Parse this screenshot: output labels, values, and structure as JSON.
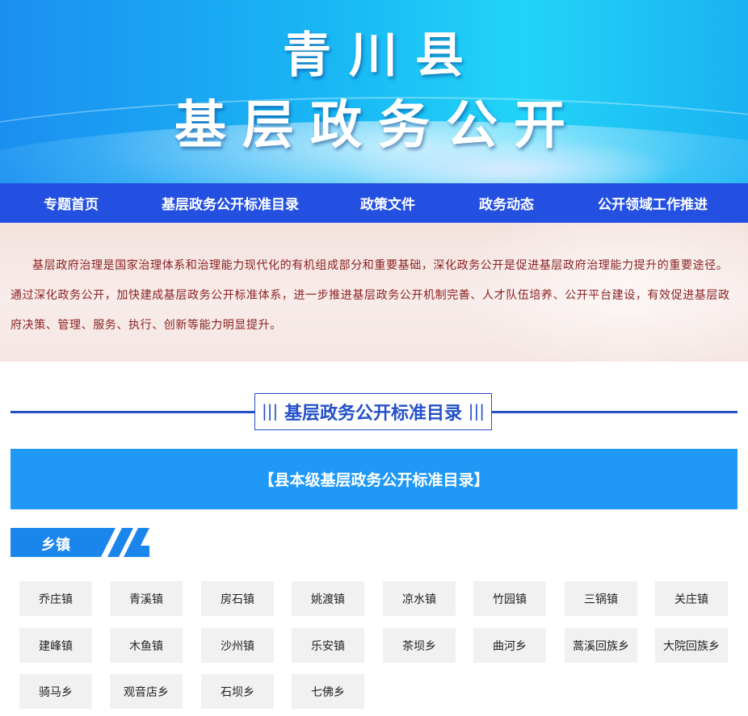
{
  "banner": {
    "line1": "青川县",
    "line2": "基层政务公开"
  },
  "nav": [
    "专题首页",
    "基层政务公开标准目录",
    "政策文件",
    "政务动态",
    "公开领域工作推进"
  ],
  "intro": "基层政府治理是国家治理体系和治理能力现代化的有机组成部分和重要基础，深化政务公开是促进基层政府治理能力提升的重要途径。通过深化政务公开，加快建成基层政务公开标准体系，进一步推进基层政务公开机制完善、人才队伍培养、公开平台建设，有效促进基层政府决策、管理、服务、执行、创新等能力明显提升。",
  "section_title": "基层政务公开标准目录",
  "county_catalog": "【县本级基层政务公开标准目录】",
  "township_tag": "乡镇",
  "townships": [
    "乔庄镇",
    "青溪镇",
    "房石镇",
    "姚渡镇",
    "凉水镇",
    "竹园镇",
    "三锅镇",
    "关庄镇",
    "建峰镇",
    "木鱼镇",
    "沙州镇",
    "乐安镇",
    "茶坝乡",
    "曲河乡",
    "蒿溪回族乡",
    "大院回族乡",
    "骑马乡",
    "观音店乡",
    "石坝乡",
    "七佛乡"
  ],
  "colors": {
    "nav_bg": "#2450e2",
    "accent": "#2450c9",
    "catalog_bg": "#1f98f6",
    "intro_text": "#8b1f1f"
  }
}
